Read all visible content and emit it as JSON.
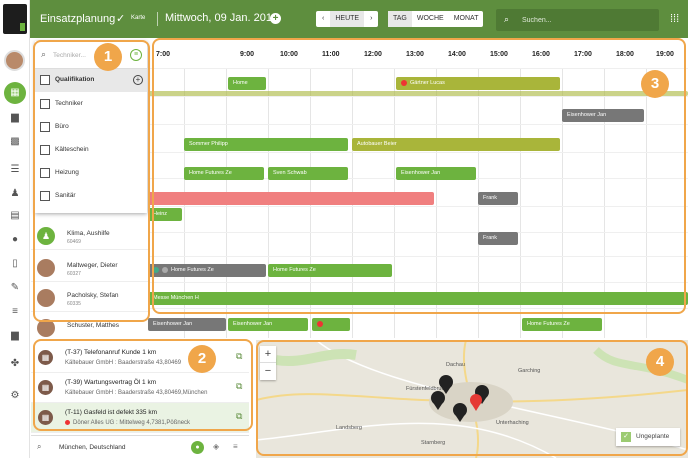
{
  "topbar": {
    "title": "Einsatzplanung",
    "karte": "Karte",
    "date": "Mittwoch, 09 Jan. 2019",
    "today": "HEUTE",
    "views": [
      "TAG",
      "WOCHE",
      "MONAT"
    ],
    "search_placeholder": "Suchen..."
  },
  "resources": [
    {
      "name": "Klima, Aushilfe",
      "id": "60469"
    },
    {
      "name": "Maltweger, Dieter",
      "id": "60327"
    },
    {
      "name": "Pacholsky, Stefan",
      "id": "60335"
    },
    {
      "name": "Schuster, Matthes",
      "id": ""
    }
  ],
  "dropdown": {
    "placeholder": "Techniker...",
    "header": "Qualifikation",
    "items": [
      "Techniker",
      "Büro",
      "Kälteschein",
      "Heizung",
      "Sanitär"
    ]
  },
  "timeline": {
    "hours": [
      "7:00",
      "8:00",
      "9:00",
      "10:00",
      "11:00",
      "12:00",
      "13:00",
      "14:00",
      "15:00",
      "16:00",
      "17:00",
      "18:00",
      "19:00"
    ]
  },
  "callouts": [
    "1",
    "2",
    "3",
    "4"
  ],
  "jobs": [
    {
      "title": "(T-37) Telefonanruf Kunde 1 km",
      "addr": "Kältebauer GmbH : Baaderstraße 43,80469"
    },
    {
      "title": "(T-39) Wartungsvertrag Öl 1 km",
      "addr": "Kältebauer GmbH : Baaderstraße 43,80469,München"
    },
    {
      "title": "(T-11) Gasfeld ist defekt 335 km",
      "addr": "Döner Alles UG : Mittelweg 4,7381,Pößneck"
    }
  ],
  "location": "München, Deutschland",
  "map": {
    "labels": [
      "Fürstenfeldbruck",
      "Garching",
      "Unterhaching",
      "Starnberg",
      "Landsberg",
      "Dachau"
    ],
    "unplanned": "Ungeplante"
  },
  "colors": {
    "brand": "#5e8e3e",
    "accent_green": "#6db33f",
    "callout": "#f0a64a"
  }
}
